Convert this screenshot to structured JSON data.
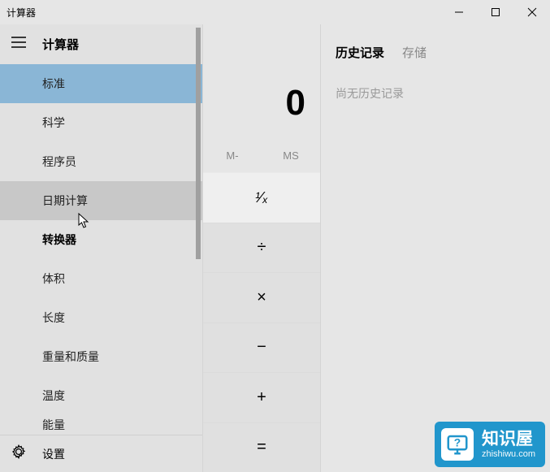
{
  "window": {
    "title": "计算器"
  },
  "nav": {
    "header": "计算器",
    "items": [
      {
        "label": "标准",
        "state": "selected"
      },
      {
        "label": "科学",
        "state": ""
      },
      {
        "label": "程序员",
        "state": ""
      },
      {
        "label": "日期计算",
        "state": "hovered"
      }
    ],
    "section": "转换器",
    "converters": [
      {
        "label": "体积"
      },
      {
        "label": "长度"
      },
      {
        "label": "重量和质量"
      },
      {
        "label": "温度"
      },
      {
        "label": "能量"
      }
    ],
    "settings": "设置"
  },
  "calc": {
    "display": "0",
    "mem": {
      "m_minus": "M-",
      "ms": "MS"
    },
    "keys": {
      "reciprocal": "¹⁄ₓ",
      "divide": "÷",
      "multiply": "×",
      "minus": "−",
      "plus": "+",
      "equals": "="
    }
  },
  "history": {
    "tab_history": "历史记录",
    "tab_memory": "存储",
    "empty": "尚无历史记录"
  },
  "watermark": {
    "main": "知识屋",
    "sub": "zhishiwu.com"
  }
}
